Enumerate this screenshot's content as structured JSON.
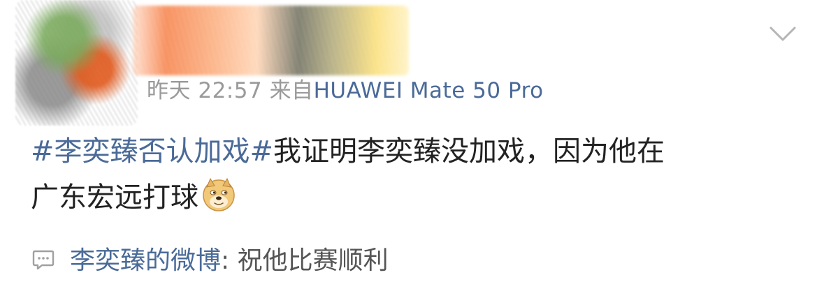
{
  "post": {
    "timestamp_day": "昨天",
    "timestamp_time": "22:57",
    "source_prefix": "来自",
    "device": "HUAWEI Mate 50 Pro",
    "topic": "#李奕臻否认加戏#",
    "text_line1": "我证明李奕臻没加戏，因为他在",
    "text_line2": "广东宏远打球",
    "emoji": "doge-emoji"
  },
  "repost": {
    "author": "李奕臻的微博",
    "separator": ":",
    "text": " 祝他比赛顺利"
  },
  "icons": {
    "expand": "chevron-down-icon",
    "comment": "comment-icon"
  },
  "colors": {
    "link": "#4a6a98",
    "meta": "#9a9a9a",
    "body": "#222222"
  }
}
